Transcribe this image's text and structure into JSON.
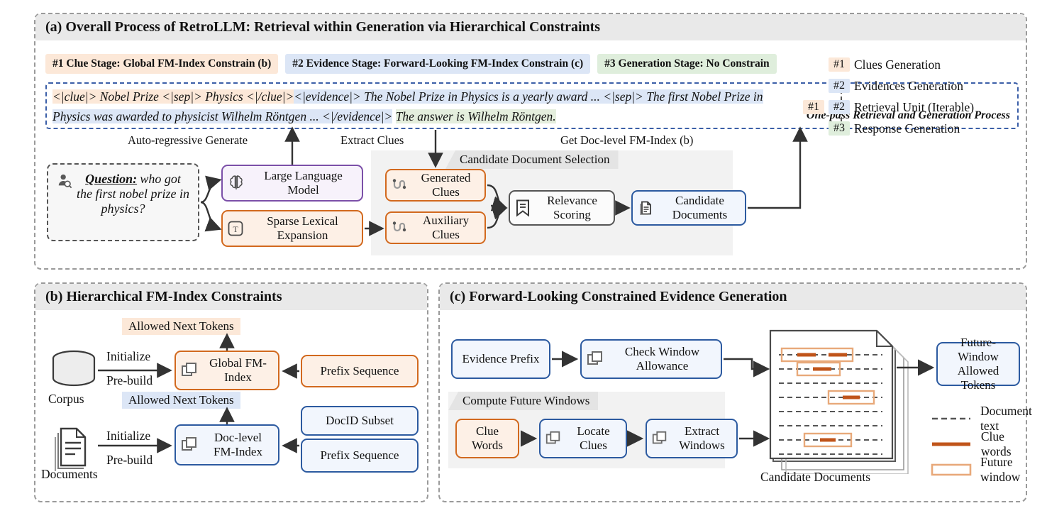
{
  "panel_a": {
    "title": "(a) Overall Process of RetroLLM: Retrieval within Generation via Hierarchical Constraints",
    "stages": [
      {
        "label": "#1 Clue Stage: Global FM-Index Constrain (b)",
        "color": "#fce8d8"
      },
      {
        "label": "#2 Evidence Stage: Forward-Looking FM-Index Constrain (c)",
        "color": "#dce6f6"
      },
      {
        "label": "#3 Generation Stage: No Constrain",
        "color": "#dfeedc"
      }
    ],
    "generation": {
      "clue_part": "<|clue|> Nobel Prize <|sep|> Physics <|/clue|>",
      "evidence_part_1": "<|evidence|> The Nobel Prize in Physics is a yearly award ... <|sep|> The first Nobel Prize in",
      "evidence_part_2": "Physics was awarded to physicist Wilhelm Röntgen ... <|/evidence|>",
      "answer_part": "The answer is Wilhelm Röntgen.",
      "side_note": "One-pass Retrieval and Generation Process"
    },
    "arrow_labels": {
      "auto_regressive": "Auto-regressive Generate",
      "extract_clues": "Extract Clues",
      "get_doc_index": "Get Doc-level FM-Index (b)"
    },
    "question_box": {
      "icon": "user-question-icon",
      "label": "Question:",
      "text": "who got the first nobel prize in physics?"
    },
    "nodes": {
      "llm": "Large Language Model",
      "sparse": "Sparse Lexical Expansion",
      "generated_clues": "Generated Clues",
      "auxiliary_clues": "Auxiliary Clues",
      "relevance": "Relevance Scoring",
      "candidate_docs": "Candidate Documents"
    },
    "group_label": "Candidate Document Selection",
    "legend": [
      {
        "tags": [
          "#1"
        ],
        "tag_colors": [
          "#fce8d8"
        ],
        "label": "Clues Generation"
      },
      {
        "tags": [
          "#2"
        ],
        "tag_colors": [
          "#dce6f6"
        ],
        "label": "Evidences Generation"
      },
      {
        "tags": [
          "#1",
          "#2"
        ],
        "tag_colors": [
          "#fce8d8",
          "#dce6f6"
        ],
        "label": "Retrieval Unit (Iterable)"
      },
      {
        "tags": [
          "#3"
        ],
        "tag_colors": [
          "#dfeedc"
        ],
        "label": "Response Generation"
      }
    ]
  },
  "panel_b": {
    "title": "(b) Hierarchical FM-Index Constraints",
    "allowed_tokens_top": "Allowed Next Tokens",
    "allowed_tokens_bottom": "Allowed Next Tokens",
    "corpus_label": "Corpus",
    "documents_label": "Documents",
    "edge_initialize_1": "Initialize",
    "edge_prebuild_1": "Pre-build",
    "edge_initialize_2": "Initialize",
    "edge_prebuild_2": "Pre-build",
    "global_fm_index": "Global FM-Index",
    "doc_level_fm_index": "Doc-level FM-Index",
    "prefix_sequence_1": "Prefix Sequence",
    "docid_subset": "DocID Subset",
    "prefix_sequence_2": "Prefix Sequence"
  },
  "panel_c": {
    "title": "(c) Forward-Looking Constrained Evidence Generation",
    "evidence_prefix": "Evidence Prefix",
    "check_window": "Check Window Allowance",
    "compute_future_windows": "Compute Future Windows",
    "clue_words": "Clue Words",
    "locate_clues": "Locate Clues",
    "extract_windows": "Extract Windows",
    "candidate_documents": "Candidate Documents",
    "future_window_allowed": "Future-Window Allowed Tokens",
    "legend": [
      {
        "type": "dashed-line",
        "label": "Document text",
        "color": "#555555"
      },
      {
        "type": "solid-line",
        "label": "Clue words",
        "color": "#c0541a"
      },
      {
        "type": "rect-outline",
        "label": "Future window",
        "color": "#e8a97a"
      }
    ]
  }
}
